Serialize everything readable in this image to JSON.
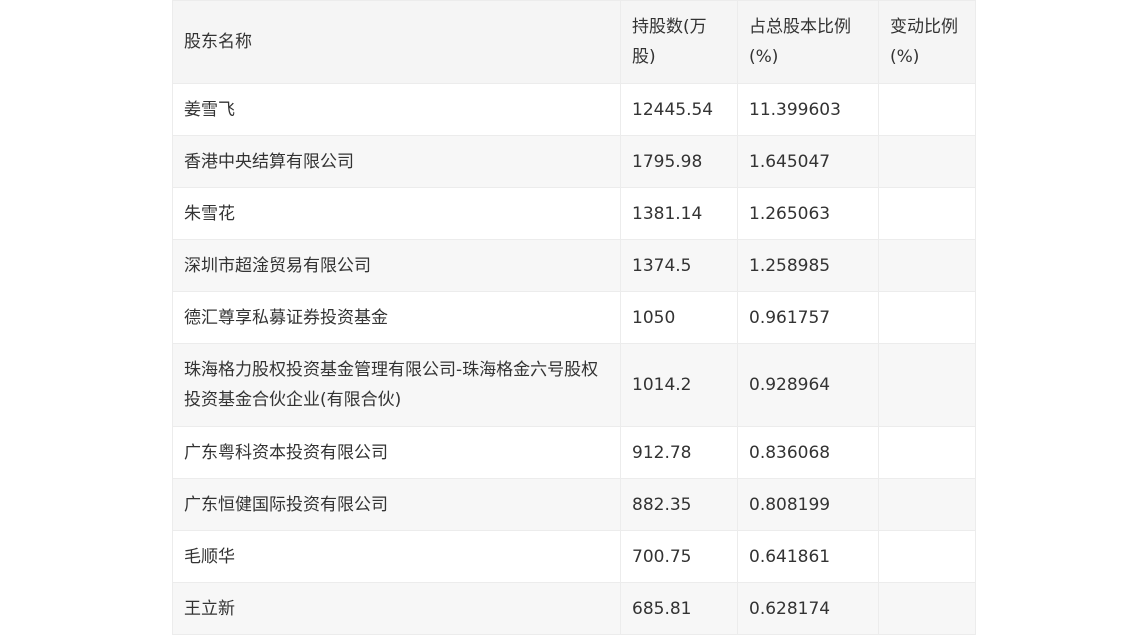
{
  "table": {
    "headers": [
      "股东名称",
      "持股数(万股)",
      "占总股本比例(%)",
      "变动比例(%)"
    ],
    "rows": [
      [
        "姜雪飞",
        "12445.54",
        "11.399603",
        ""
      ],
      [
        "香港中央结算有限公司",
        "1795.98",
        "1.645047",
        ""
      ],
      [
        "朱雪花",
        "1381.14",
        "1.265063",
        ""
      ],
      [
        "深圳市超淦贸易有限公司",
        "1374.5",
        "1.258985",
        ""
      ],
      [
        "德汇尊享私募证券投资基金",
        "1050",
        "0.961757",
        ""
      ],
      [
        "珠海格力股权投资基金管理有限公司-珠海格金六号股权投资基金合伙企业(有限合伙)",
        "1014.2",
        "0.928964",
        ""
      ],
      [
        "广东粤科资本投资有限公司",
        "912.78",
        "0.836068",
        ""
      ],
      [
        "广东恒健国际投资有限公司",
        "882.35",
        "0.808199",
        ""
      ],
      [
        "毛顺华",
        "700.75",
        "0.641861",
        ""
      ],
      [
        "王立新",
        "685.81",
        "0.628174",
        ""
      ]
    ]
  }
}
